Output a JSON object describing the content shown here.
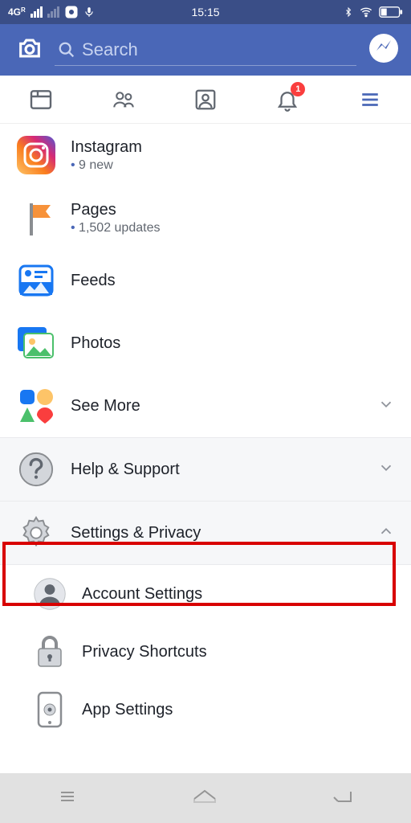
{
  "status": {
    "network_label": "4G",
    "network_sub": "R",
    "time": "15:15"
  },
  "search": {
    "placeholder": "Search"
  },
  "tabs": {
    "notif_count": "1"
  },
  "menu": {
    "instagram": {
      "title": "Instagram",
      "subtitle": "9 new"
    },
    "pages": {
      "title": "Pages",
      "subtitle": "1,502 updates"
    },
    "feeds": {
      "title": "Feeds"
    },
    "photos": {
      "title": "Photos"
    },
    "see_more": {
      "title": "See More"
    },
    "help": {
      "title": "Help & Support"
    },
    "settings_privacy": {
      "title": "Settings & Privacy"
    },
    "account_settings": {
      "title": "Account Settings"
    },
    "privacy_shortcuts": {
      "title": "Privacy Shortcuts"
    },
    "app_settings": {
      "title": "App Settings"
    }
  }
}
